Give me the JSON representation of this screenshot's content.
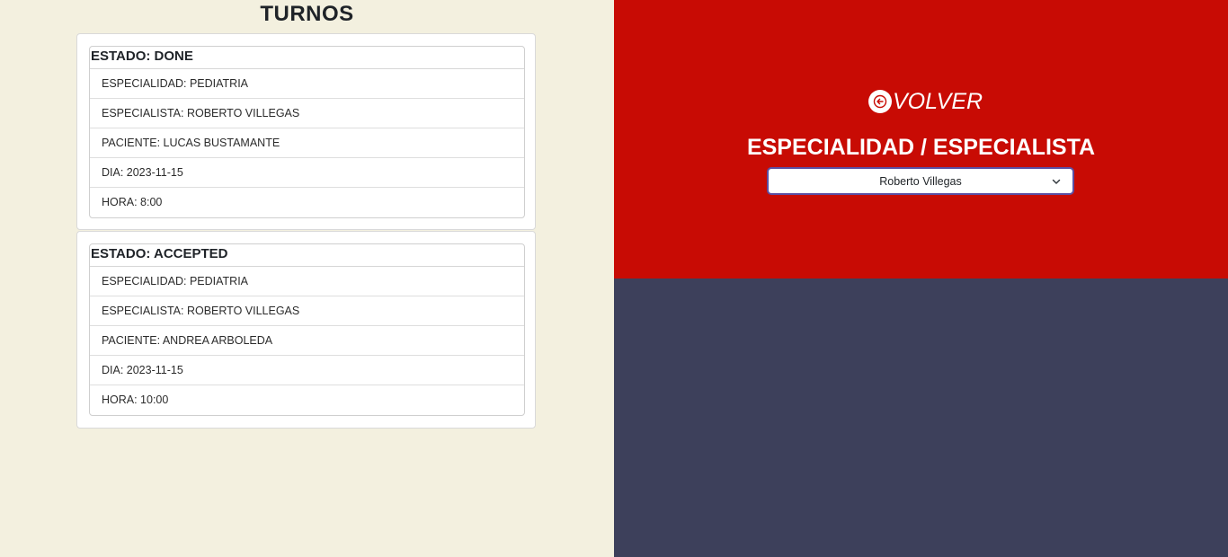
{
  "left_panel": {
    "title": "TURNOS",
    "appointments": [
      {
        "estado": "ESTADO: DONE",
        "especialidad": "ESPECIALIDAD: PEDIATRIA",
        "especialista": "ESPECIALISTA: ROBERTO VILLEGAS",
        "paciente": "PACIENTE: LUCAS BUSTAMANTE",
        "dia": "DIA: 2023-11-15",
        "hora": "HORA: 8:00"
      },
      {
        "estado": "ESTADO: ACCEPTED",
        "especialidad": "ESPECIALIDAD: PEDIATRIA",
        "especialista": "ESPECIALISTA: ROBERTO VILLEGAS",
        "paciente": "PACIENTE: ANDREA ARBOLEDA",
        "dia": "DIA: 2023-11-15",
        "hora": "HORA: 10:00"
      }
    ]
  },
  "right_panel": {
    "back_label": "VOLVER",
    "back_icon": "arrow-left-circle-icon",
    "section_title": "ESPECIALIDAD / ESPECIALISTA",
    "select": {
      "selected": "Roberto Villegas",
      "icon": "chevron-down-icon"
    }
  },
  "colors": {
    "left_bg": "#f3f0df",
    "right_top_bg": "#c80b04",
    "right_bottom_bg": "#3d405b",
    "select_border": "#5b4fa3"
  }
}
